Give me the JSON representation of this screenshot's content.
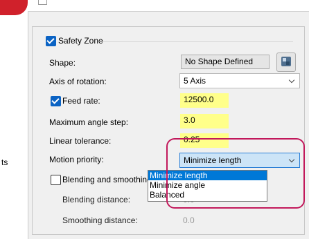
{
  "left_panel": {
    "text": "ts"
  },
  "group": {
    "title": "Safety Zone",
    "checked": true
  },
  "shape": {
    "label": "Shape:",
    "value": "No Shape Defined",
    "icon": "cube-icon"
  },
  "axis": {
    "label": "Axis of rotation:",
    "value": "5 Axis"
  },
  "feed_rate": {
    "label": "Feed rate:",
    "value": "12500.0",
    "checked": true
  },
  "max_angle_step": {
    "label": "Maximum angle step:",
    "value": "3.0"
  },
  "linear_tolerance": {
    "label": "Linear tolerance:",
    "value": "0.25"
  },
  "motion_priority": {
    "label": "Motion priority:",
    "value": "Minimize length",
    "options": [
      "Minimize length",
      "Minimize angle",
      "Balanced"
    ],
    "highlighted_index": 0
  },
  "blending": {
    "label": "Blending and smoothing",
    "checked": false
  },
  "blending_distance": {
    "label": "Blending distance:",
    "value": "0.0"
  },
  "smoothing_distance": {
    "label": "Smoothing distance:",
    "value": "0.0"
  },
  "colors": {
    "accent": "#0078d7",
    "highlight_field": "#ffff8a",
    "annotation": "#c2185b",
    "badge": "#d0212b"
  }
}
